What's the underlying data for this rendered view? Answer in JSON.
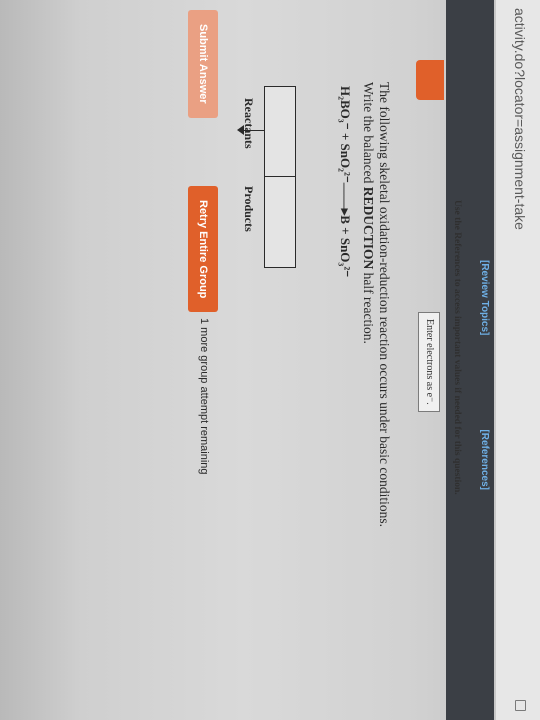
{
  "browser": {
    "url": "activity.do?locator=assignment-take"
  },
  "nav": {
    "review_topics": "[Review Topics]",
    "references": "[References]"
  },
  "instructions": "Use the References to access important values if needed for this question.",
  "electrons_hint": "Enter electrons as e⁻.",
  "question": {
    "prefix": "The following skeletal oxidation-reduction reaction occurs under basic conditions. Write the balanced ",
    "bold": "REDUCTION",
    "suffix": " half reaction."
  },
  "equation": {
    "reactant1": "H₂BO₃⁻",
    "plus1": " + ",
    "reactant2": "SnO₂²⁻",
    "arrow": "——▸",
    "product1": "B",
    "plus2": " + ",
    "product2": "SnO₃²⁻"
  },
  "answer": {
    "reactants_label": "Reactants",
    "products_label": "Products",
    "reactants_value": "",
    "products_value": ""
  },
  "buttons": {
    "submit": "Submit Answer",
    "retry": "Retry Entire Group"
  },
  "status": {
    "attempts_remaining": "1 more group attempt remaining"
  },
  "colors": {
    "accent": "#e0602a",
    "submit_disabled": "#eaa083",
    "link": "#6fb0e6",
    "header_bar": "#3b3f45"
  }
}
